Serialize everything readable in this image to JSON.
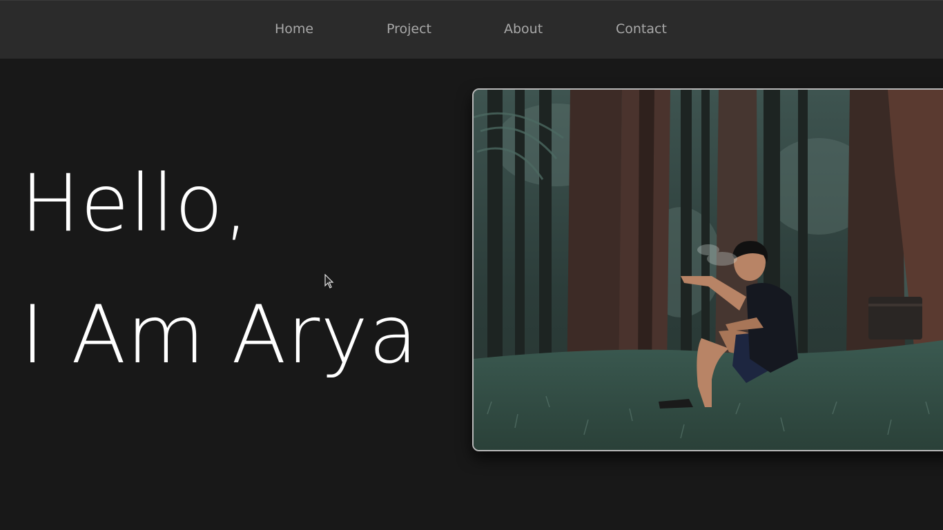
{
  "nav": {
    "items": [
      {
        "label": "Home"
      },
      {
        "label": "Project"
      },
      {
        "label": "About"
      },
      {
        "label": "Contact"
      }
    ]
  },
  "hero": {
    "line1": "Hello,",
    "line2": "I Am Arya"
  },
  "colors": {
    "page_background": "#181818",
    "navbar_background": "#2b2b2b",
    "nav_text": "#a9a9a9",
    "hero_text": "#ffffff",
    "frame_border": "#b9b9b9"
  }
}
